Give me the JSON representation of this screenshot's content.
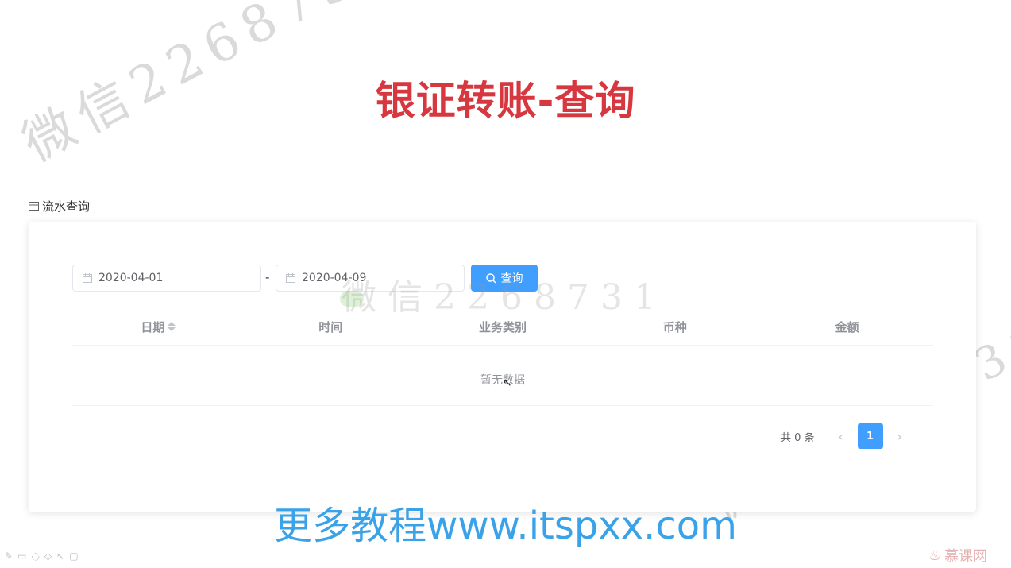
{
  "slide_title": "银证转账-查询",
  "section": {
    "icon": "card-icon",
    "title": "流水查询"
  },
  "filter": {
    "start_date": "2020-04-01",
    "range_separator": "-",
    "end_date": "2020-04-09",
    "query_label": "查询"
  },
  "table": {
    "columns": [
      {
        "label": "日期",
        "sortable": true
      },
      {
        "label": "时间"
      },
      {
        "label": "业务类别"
      },
      {
        "label": "币种"
      },
      {
        "label": "金额"
      }
    ],
    "empty_text": "暂无数据"
  },
  "pagination": {
    "total_text": "共 0 条",
    "current_page": "1"
  },
  "watermark": "微信2268731",
  "promo_text": "更多教程www.itspxx.com",
  "brand": "慕课网",
  "colors": {
    "title": "#d7373f",
    "primary": "#409eff",
    "promo": "#3aa2e8"
  }
}
